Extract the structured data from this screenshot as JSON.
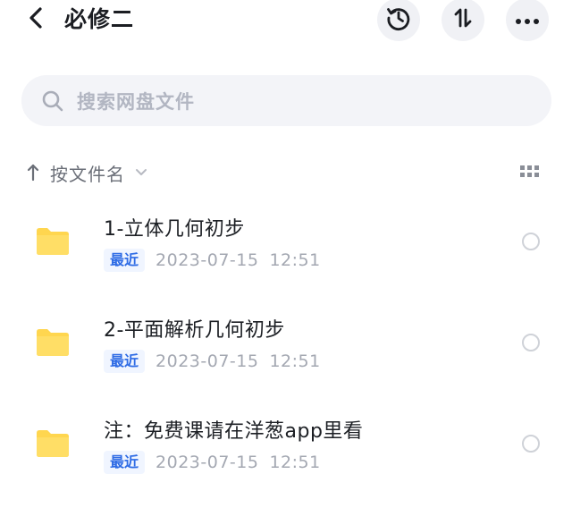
{
  "header": {
    "title": "必修二",
    "icons": {
      "back": "chevron-left-icon",
      "history": "history-icon",
      "sort": "sort-icon",
      "more": "more-icon"
    }
  },
  "search": {
    "placeholder": "搜索网盘文件",
    "icon": "search-icon"
  },
  "sort": {
    "label": "按文件名",
    "direction": "ascending"
  },
  "view_toggle": {
    "icon": "grid-view-icon"
  },
  "files": [
    {
      "name": "1-立体几何初步",
      "badge": "最近",
      "date": "2023-07-15",
      "time": "12:51",
      "type": "folder"
    },
    {
      "name": "2-平面解析几何初步",
      "badge": "最近",
      "date": "2023-07-15",
      "time": "12:51",
      "type": "folder"
    },
    {
      "name": "注：免费课请在洋葱app里看",
      "badge": "最近",
      "date": "2023-07-15",
      "time": "12:51",
      "type": "folder"
    }
  ],
  "colors": {
    "folder": "#FFD64F",
    "badge_text": "#2F6CE5",
    "badge_bg": "#F0F5FF",
    "search_bg": "#F3F4F8",
    "round_button_bg": "#F0F1F5"
  }
}
